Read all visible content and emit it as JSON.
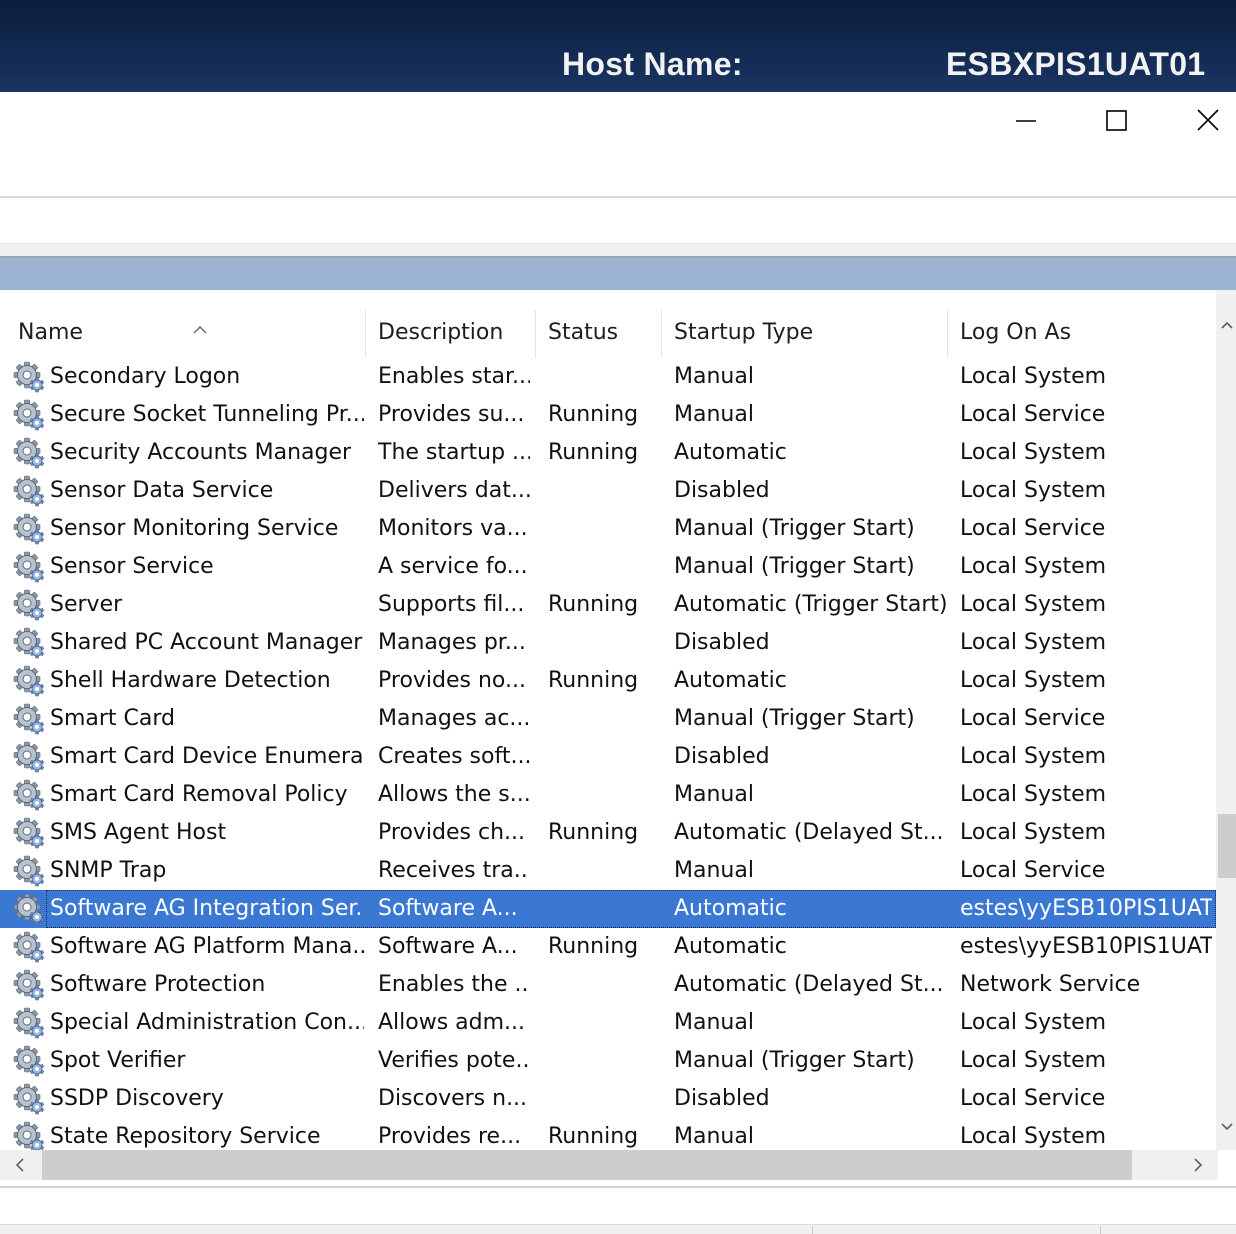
{
  "banner": {
    "host_label": "Host Name:",
    "host_value": "ESBXPIS1UAT01"
  },
  "window": {
    "minimize_icon": "minimize-icon",
    "maximize_icon": "maximize-icon",
    "close_icon": "close-icon"
  },
  "columns": [
    {
      "label": "Name"
    },
    {
      "label": "Description"
    },
    {
      "label": "Status"
    },
    {
      "label": "Startup Type"
    },
    {
      "label": "Log On As"
    }
  ],
  "sort": {
    "column": "Name",
    "direction": "ascending",
    "icon": "sort-ascending-icon"
  },
  "service_icon": "service-gear-icon",
  "services": [
    {
      "name": "Secondary Logon",
      "description": "Enables star...",
      "status": "",
      "startup": "Manual",
      "logon": "Local System"
    },
    {
      "name": "Secure Socket Tunneling Pr...",
      "description": "Provides su...",
      "status": "Running",
      "startup": "Manual",
      "logon": "Local Service"
    },
    {
      "name": "Security Accounts Manager",
      "description": "The startup ...",
      "status": "Running",
      "startup": "Automatic",
      "logon": "Local System"
    },
    {
      "name": "Sensor Data Service",
      "description": "Delivers dat...",
      "status": "",
      "startup": "Disabled",
      "logon": "Local System"
    },
    {
      "name": "Sensor Monitoring Service",
      "description": "Monitors va...",
      "status": "",
      "startup": "Manual (Trigger Start)",
      "logon": "Local Service"
    },
    {
      "name": "Sensor Service",
      "description": "A service fo...",
      "status": "",
      "startup": "Manual (Trigger Start)",
      "logon": "Local System"
    },
    {
      "name": "Server",
      "description": "Supports fil...",
      "status": "Running",
      "startup": "Automatic (Trigger Start)",
      "logon": "Local System"
    },
    {
      "name": "Shared PC Account Manager",
      "description": "Manages pr...",
      "status": "",
      "startup": "Disabled",
      "logon": "Local System"
    },
    {
      "name": "Shell Hardware Detection",
      "description": "Provides no...",
      "status": "Running",
      "startup": "Automatic",
      "logon": "Local System"
    },
    {
      "name": "Smart Card",
      "description": "Manages ac...",
      "status": "",
      "startup": "Manual (Trigger Start)",
      "logon": "Local Service"
    },
    {
      "name": "Smart Card Device Enumera...",
      "description": "Creates soft...",
      "status": "",
      "startup": "Disabled",
      "logon": "Local System"
    },
    {
      "name": "Smart Card Removal Policy",
      "description": "Allows the s...",
      "status": "",
      "startup": "Manual",
      "logon": "Local System"
    },
    {
      "name": "SMS Agent Host",
      "description": "Provides ch...",
      "status": "Running",
      "startup": "Automatic (Delayed St...",
      "logon": "Local System"
    },
    {
      "name": "SNMP Trap",
      "description": "Receives tra...",
      "status": "",
      "startup": "Manual",
      "logon": "Local Service"
    },
    {
      "name": "Software AG Integration Ser...",
      "description": "Software A...",
      "status": "",
      "startup": "Automatic",
      "logon": "estes\\yyESB10PIS1UAT",
      "selected": true
    },
    {
      "name": "Software AG Platform Mana...",
      "description": "Software A...",
      "status": "Running",
      "startup": "Automatic",
      "logon": "estes\\yyESB10PIS1UAT"
    },
    {
      "name": "Software Protection",
      "description": "Enables the ...",
      "status": "",
      "startup": "Automatic (Delayed St...",
      "logon": "Network Service"
    },
    {
      "name": "Special Administration Con...",
      "description": "Allows adm...",
      "status": "",
      "startup": "Manual",
      "logon": "Local System"
    },
    {
      "name": "Spot Verifier",
      "description": "Verifies pote...",
      "status": "",
      "startup": "Manual (Trigger Start)",
      "logon": "Local System"
    },
    {
      "name": "SSDP Discovery",
      "description": "Discovers n...",
      "status": "",
      "startup": "Disabled",
      "logon": "Local Service"
    },
    {
      "name": "State Repository Service",
      "description": "Provides re...",
      "status": "Running",
      "startup": "Manual",
      "logon": "Local System"
    }
  ],
  "colors": {
    "banner": "#132a52",
    "selection": "#3a78d4",
    "header_band": "#9cb4d2"
  }
}
